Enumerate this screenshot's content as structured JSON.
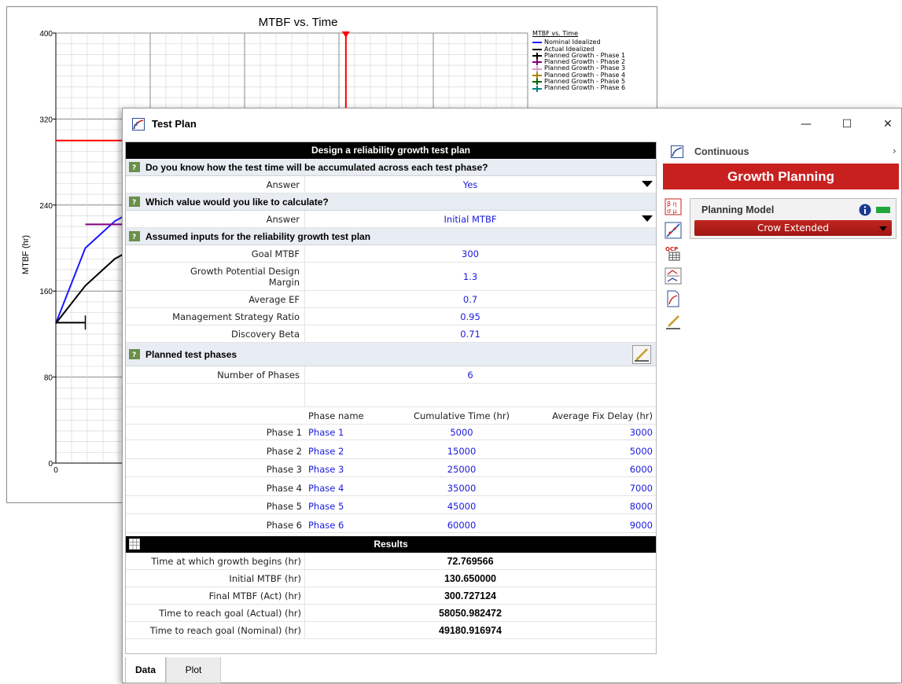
{
  "chart_data": {
    "type": "line",
    "title": "MTBF vs. Time",
    "ylabel": "MTBF (hr)",
    "xlabel": "",
    "ylim": [
      0,
      400
    ],
    "y_ticks": [
      "0",
      "80",
      "160",
      "240",
      "320",
      "400"
    ],
    "x_ticks": [
      "0"
    ],
    "grid": true,
    "legend_position": "top-right",
    "legend_title": "MTBF vs. Time",
    "legend": [
      {
        "name": "Nominal Idealized",
        "color": "#1a1aff"
      },
      {
        "name": "Actual Idealized",
        "color": "#000000"
      },
      {
        "name": "Planned Growth - Phase 1",
        "color": "#000000"
      },
      {
        "name": "Planned Growth - Phase 2",
        "color": "#800080"
      },
      {
        "name": "Planned Growth - Phase 3",
        "color": "#d4a0d0"
      },
      {
        "name": "Planned Growth - Phase 4",
        "color": "#b08000"
      },
      {
        "name": "Planned Growth - Phase 5",
        "color": "#006400"
      },
      {
        "name": "Planned Growth - Phase 6",
        "color": "#008080"
      }
    ],
    "series": [
      {
        "name": "Nominal Idealized",
        "color": "#1a1aff",
        "x": [
          0,
          5000,
          10000,
          15000,
          20000,
          25000,
          30000,
          35000
        ],
        "y": [
          130,
          200,
          225,
          240,
          250,
          258,
          264,
          270
        ]
      },
      {
        "name": "Actual Idealized",
        "color": "#000000",
        "x": [
          0,
          5000,
          10000,
          15000,
          20000,
          25000,
          30000,
          35000
        ],
        "y": [
          130,
          165,
          190,
          205,
          215,
          222,
          226,
          230
        ]
      },
      {
        "name": "Planned Growth - Phase 1",
        "color": "#000000",
        "x": [
          0,
          5000
        ],
        "y": [
          130.65,
          130.65
        ]
      },
      {
        "name": "Planned Growth - Phase 2",
        "color": "#800080",
        "x": [
          5000,
          15000
        ],
        "y": [
          222,
          222
        ]
      }
    ],
    "goal_line": {
      "value": 300,
      "color": "#ff0000"
    },
    "marker_line_color": "#ff0000"
  },
  "dialog": {
    "title": "Test Plan",
    "controls": {
      "minimize": "—",
      "maximize": "☐",
      "close": "✕"
    }
  },
  "grid": {
    "header": "Design a reliability growth test plan",
    "sections": {
      "s1": "Do you know how the test time will be accumulated across each test phase?",
      "s2": "Which value would you like to calculate?",
      "s3": "Assumed inputs for the reliability growth test plan",
      "s4": "Planned test phases"
    },
    "answer_label": "Answer",
    "answer1": "Yes",
    "answer2": "Initial MTBF",
    "inputs": [
      {
        "label": "Goal MTBF",
        "value": "300"
      },
      {
        "label": "Growth Potential Design Margin",
        "value": "1.3"
      },
      {
        "label": "Average EF",
        "value": "0.7"
      },
      {
        "label": "Management Strategy Ratio",
        "value": "0.95"
      },
      {
        "label": "Discovery Beta",
        "value": "0.71"
      }
    ],
    "num_phases_label": "Number of Phases",
    "num_phases": "6",
    "phase_headers": {
      "name": "Phase name",
      "cum": "Cumulative Time (hr)",
      "delay": "Average Fix Delay (hr)"
    },
    "phases": [
      {
        "row": "Phase 1",
        "name": "Phase 1",
        "cum": "5000",
        "delay": "3000"
      },
      {
        "row": "Phase 2",
        "name": "Phase 2",
        "cum": "15000",
        "delay": "5000"
      },
      {
        "row": "Phase 3",
        "name": "Phase 3",
        "cum": "25000",
        "delay": "6000"
      },
      {
        "row": "Phase 4",
        "name": "Phase 4",
        "cum": "35000",
        "delay": "7000"
      },
      {
        "row": "Phase 5",
        "name": "Phase 5",
        "cum": "45000",
        "delay": "8000"
      },
      {
        "row": "Phase 6",
        "name": "Phase 6",
        "cum": "60000",
        "delay": "9000"
      }
    ],
    "results_header": "Results",
    "results": [
      {
        "label": "Time at which growth begins (hr)",
        "value": "72.769566"
      },
      {
        "label": "Initial MTBF (hr)",
        "value": "130.650000"
      },
      {
        "label": "Final MTBF (Act) (hr)",
        "value": "300.727124"
      },
      {
        "label": "Time to reach goal (Actual) (hr)",
        "value": "58050.982472"
      },
      {
        "label": "Time to reach goal (Nominal) (hr)",
        "value": "49180.916974"
      }
    ]
  },
  "tabs": {
    "data": "Data",
    "plot": "Plot"
  },
  "right_panel": {
    "mode": "Continuous",
    "banner": "Growth Planning",
    "planning_model_label": "Planning Model",
    "planning_model_value": "Crow Extended",
    "accent": "#c8201f"
  }
}
